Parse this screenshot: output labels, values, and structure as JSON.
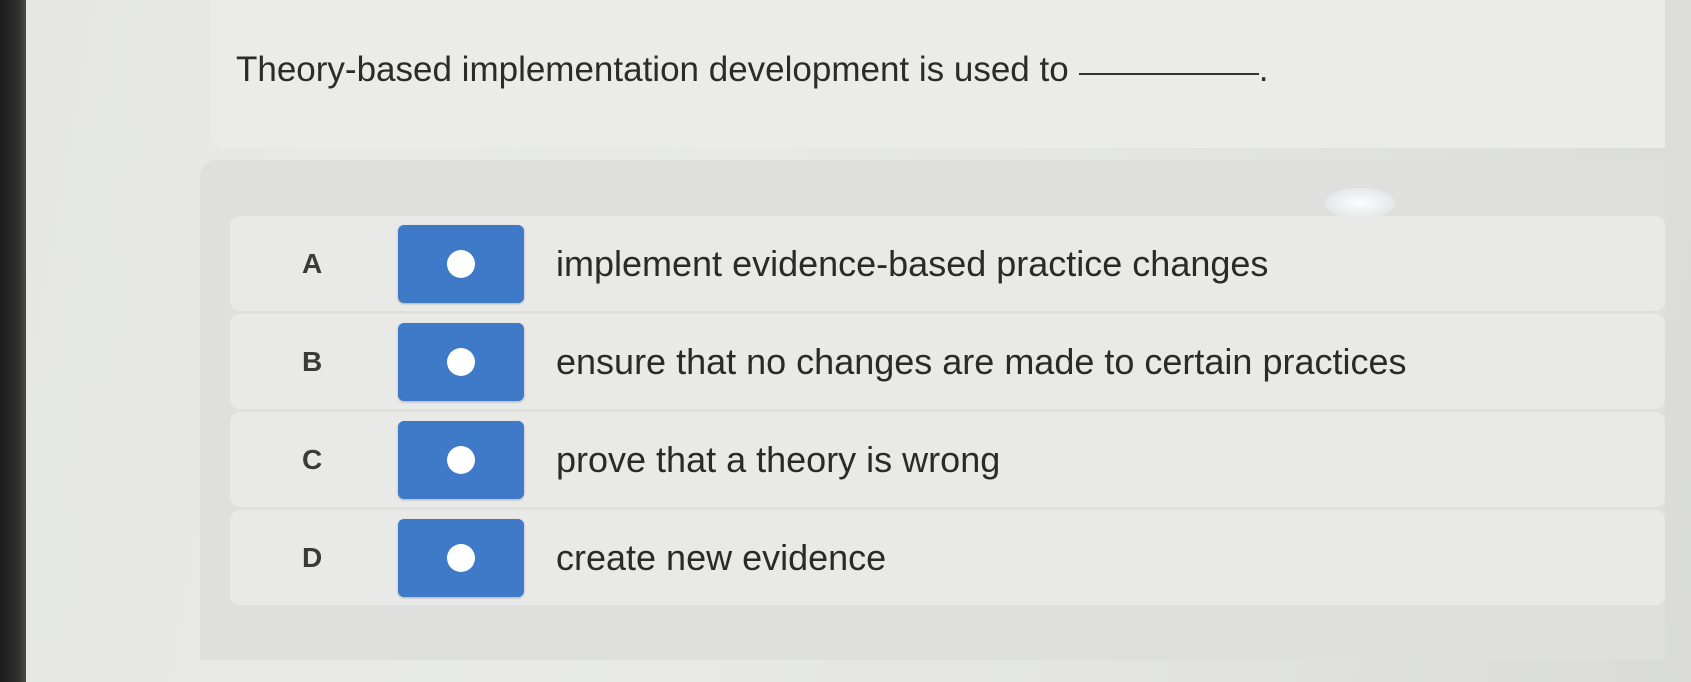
{
  "question": {
    "text": "Theory-based implementation development is used to",
    "blank_end": "."
  },
  "options": [
    {
      "letter": "A",
      "text": "implement evidence-based practice changes",
      "selected": false
    },
    {
      "letter": "B",
      "text": "ensure that no changes are made to certain practices",
      "selected": false
    },
    {
      "letter": "C",
      "text": "prove that a theory is wrong",
      "selected": false
    },
    {
      "letter": "D",
      "text": "create new evidence",
      "selected": false
    }
  ],
  "colors": {
    "accent": "#3f7ac8",
    "background": "#e7e8e6"
  }
}
